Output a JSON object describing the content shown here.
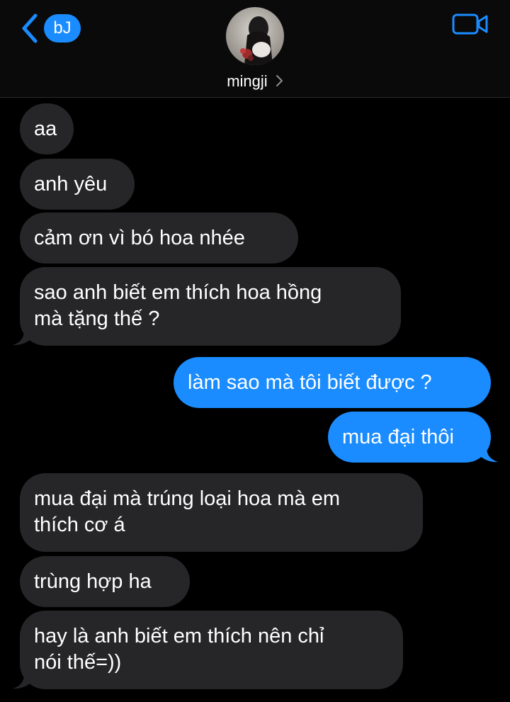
{
  "header": {
    "back_label": "bJ",
    "contact_name": "mingji"
  },
  "colors": {
    "accent": "#1a8cff",
    "incoming_bubble": "#262628",
    "background": "#000000"
  },
  "icons": {
    "back": "chevron-left-icon",
    "video": "video-camera-icon",
    "contact_more": "chevron-right-icon"
  },
  "messages": [
    {
      "from": "them",
      "lines": [
        "aa"
      ]
    },
    {
      "from": "them",
      "lines": [
        "anh yêu"
      ]
    },
    {
      "from": "them",
      "lines": [
        "cảm ơn vì bó hoa nhée"
      ]
    },
    {
      "from": "them",
      "lines": [
        "sao anh biết em thích hoa hồng",
        "mà tặng thế ?"
      ]
    },
    {
      "from": "me",
      "lines": [
        "làm sao mà tôi biết được ?"
      ]
    },
    {
      "from": "me",
      "lines": [
        "mua đại thôi"
      ]
    },
    {
      "from": "them",
      "lines": [
        "mua đại mà trúng loại hoa mà em",
        "thích cơ á"
      ]
    },
    {
      "from": "them",
      "lines": [
        "trùng hợp ha"
      ]
    },
    {
      "from": "them",
      "lines": [
        "hay là anh biết em thích nên chỉ",
        "nói thế=))"
      ]
    }
  ]
}
